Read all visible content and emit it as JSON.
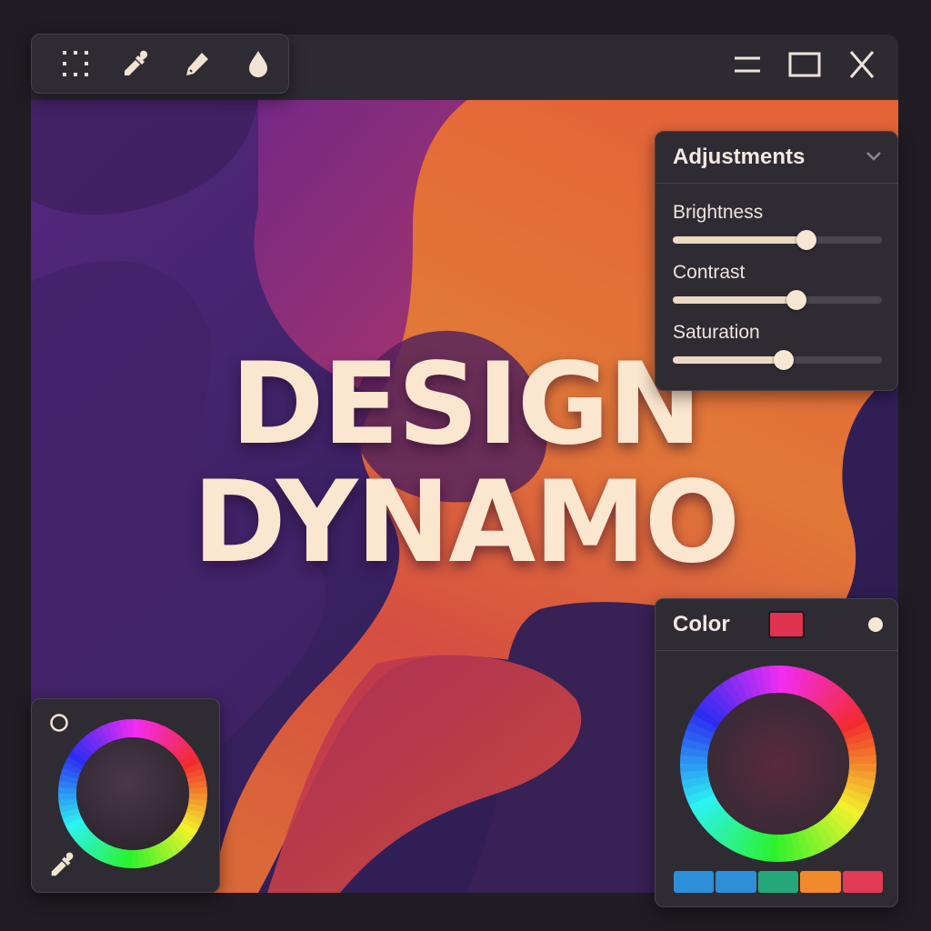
{
  "toolbar": {
    "tools": [
      "grid-select-icon",
      "eyedropper-icon",
      "pencil-icon",
      "water-drop-icon"
    ]
  },
  "window_controls": [
    "minimize-icon",
    "maximize-icon",
    "close-icon"
  ],
  "canvas": {
    "title_line1": "DESIGN",
    "title_line2": "DYNAMO",
    "text_color": "#fbe6cf"
  },
  "adjustments": {
    "title": "Adjustments",
    "sliders": [
      {
        "label": "Brightness",
        "value": 0.64
      },
      {
        "label": "Contrast",
        "value": 0.59
      },
      {
        "label": "Saturation",
        "value": 0.53
      }
    ]
  },
  "color_panel": {
    "title": "Color",
    "current_color": "#e0334f",
    "swatches": [
      "#2d8fd8",
      "#2e8ed6",
      "#24a87a",
      "#f08a2a",
      "#e23b55"
    ]
  },
  "small_picker": {
    "icons": [
      "ring-icon",
      "eyedropper-icon"
    ]
  }
}
